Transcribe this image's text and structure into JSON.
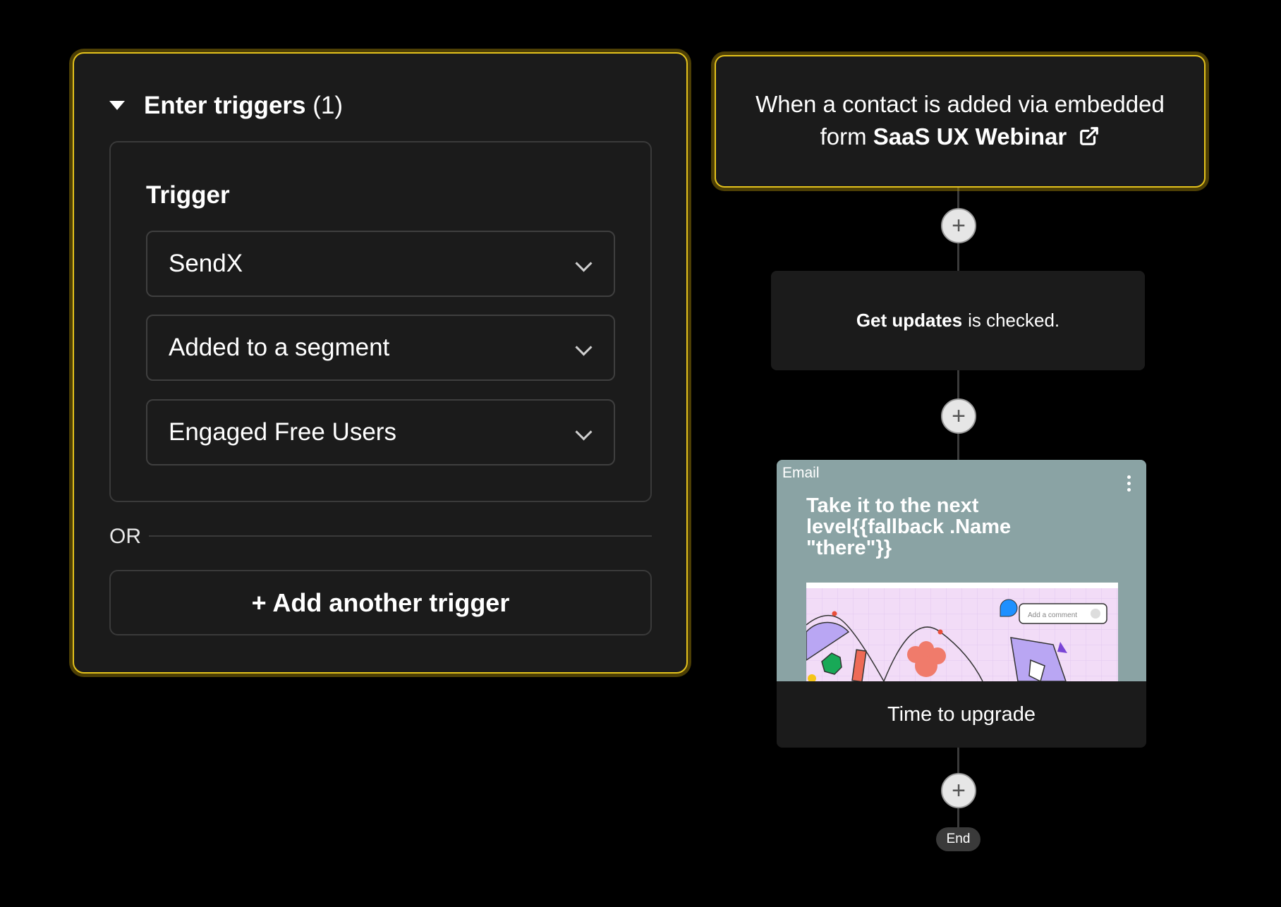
{
  "triggers_panel": {
    "title": "Enter triggers",
    "count": "(1)",
    "trigger_label": "Trigger",
    "selects": [
      "SendX",
      "Added to a segment",
      "Engaged Free Users"
    ],
    "or_label": "OR",
    "add_button": "+ Add another trigger"
  },
  "flow": {
    "start_node": {
      "text_prefix": "When a contact is added via embedded form",
      "form_name": "SaaS UX Webinar",
      "icon": "external-link-icon"
    },
    "condition": {
      "field": "Get updates",
      "text_suffix": "is checked."
    },
    "email": {
      "tag": "Email",
      "heading": "Take it to the next level{{fallback .Name \"there\"}}",
      "preview_comment_placeholder": "Add a comment",
      "title": "Time to upgrade"
    },
    "add_step_label": "+",
    "end_label": "End"
  },
  "colors": {
    "background": "#000000",
    "panel": "#1b1b1b",
    "accent_border": "#e4c21c",
    "email_header": "#8aa3a4"
  }
}
